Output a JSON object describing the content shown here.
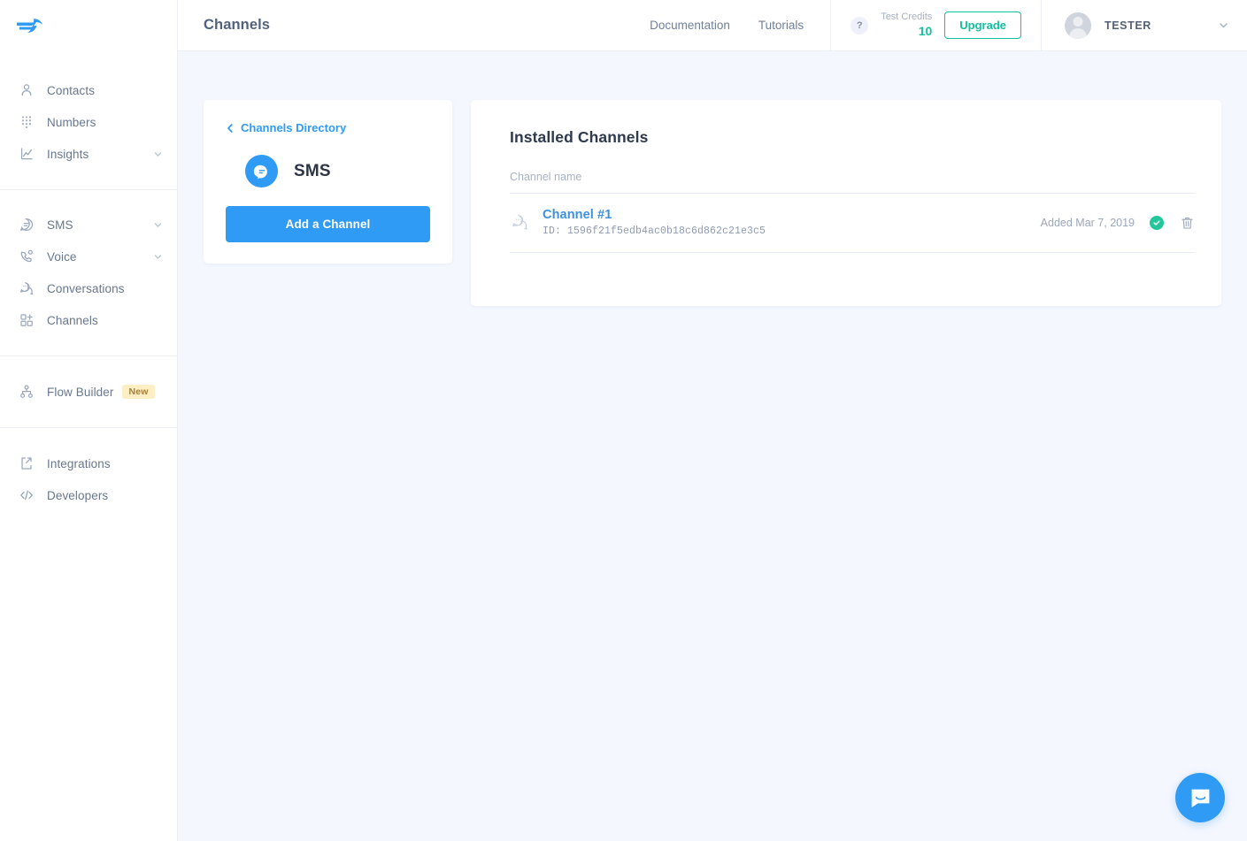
{
  "brand": {
    "logo_name": "messagebird-logo",
    "primary": "#2F9BF5",
    "accent_teal": "#12BF9F"
  },
  "sidebar": {
    "groups": [
      {
        "items": [
          {
            "label": "Contacts",
            "icon": "contacts-icon",
            "chevron": false
          },
          {
            "label": "Numbers",
            "icon": "numbers-icon",
            "chevron": false
          },
          {
            "label": "Insights",
            "icon": "insights-icon",
            "chevron": true
          }
        ]
      },
      {
        "items": [
          {
            "label": "SMS",
            "icon": "sms-icon",
            "chevron": true
          },
          {
            "label": "Voice",
            "icon": "voice-icon",
            "chevron": true
          },
          {
            "label": "Conversations",
            "icon": "conversations-icon",
            "chevron": false
          },
          {
            "label": "Channels",
            "icon": "channels-icon",
            "chevron": false
          }
        ]
      },
      {
        "items": [
          {
            "label": "Flow Builder",
            "icon": "flow-builder-icon",
            "chevron": false,
            "badge": "New"
          }
        ]
      },
      {
        "items": [
          {
            "label": "Integrations",
            "icon": "integrations-icon",
            "chevron": false
          },
          {
            "label": "Developers",
            "icon": "developers-icon",
            "chevron": false
          }
        ]
      }
    ]
  },
  "topbar": {
    "title": "Channels",
    "links": [
      {
        "label": "Documentation"
      },
      {
        "label": "Tutorials"
      }
    ],
    "help_label": "?",
    "credits_label": "Test Credits",
    "credits_value": "10",
    "upgrade_label": "Upgrade",
    "user_name": "TESTER"
  },
  "channel_panel": {
    "back_label": "Channels Directory",
    "channel_name": "SMS",
    "add_button_label": "Add a Channel"
  },
  "installed": {
    "title": "Installed Channels",
    "column_header": "Channel name",
    "rows": [
      {
        "name": "Channel #1",
        "id_text": "ID: 1596f21f5edb4ac0b18c6d862c21e3c5",
        "added": "Added Mar 7, 2019",
        "status": "active"
      }
    ]
  },
  "chat_widget": {
    "icon": "intercom-chat-icon"
  }
}
